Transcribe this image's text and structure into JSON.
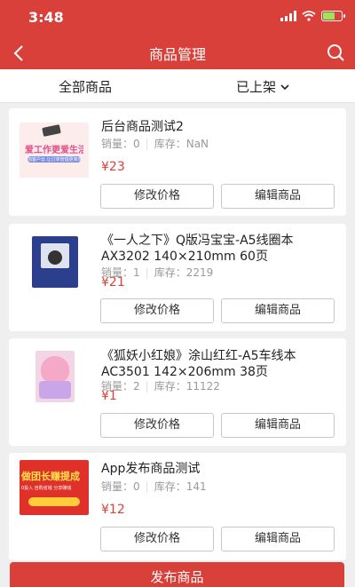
{
  "status_bar": {
    "time": "3:48"
  },
  "nav": {
    "title": "商品管理"
  },
  "filters": {
    "all_label": "全部商品",
    "status_label": "已上架"
  },
  "products": [
    {
      "title": "后台商品测试2",
      "sales_label": "销量：",
      "sales": "0",
      "stock_label": "库存：",
      "stock": "NaN",
      "price": "¥23",
      "thumb_text_1": "爱工作更爱生活",
      "thumb_text_2": "加客户云 让订单管理更简单"
    },
    {
      "title": "《一人之下》Q版冯宝宝-A5线圈本AX3202 140×210mm 60页",
      "sales_label": "销量：",
      "sales": "1",
      "stock_label": "库存：",
      "stock": "2219",
      "price": "¥21"
    },
    {
      "title": "《狐妖小红娘》涂山红红-A5车线本AC3501 142×206mm 38页",
      "sales_label": "销量：",
      "sales": "2",
      "stock_label": "库存：",
      "stock": "11122",
      "price": "¥1"
    },
    {
      "title": "App发布商品测试",
      "sales_label": "销量：",
      "sales": "0",
      "stock_label": "库存：",
      "stock": "141",
      "price": "¥12",
      "thumb_text_1": "做团长赚提成",
      "thumb_text_2": "0投入 自购省钱 分享赚钱"
    }
  ],
  "buttons": {
    "edit_price": "修改价格",
    "edit_product": "编辑商品"
  },
  "footer": {
    "publish_label": "发布商品"
  },
  "colors": {
    "brand": "#d9403a",
    "price": "#d9403a",
    "background": "#efefef"
  }
}
